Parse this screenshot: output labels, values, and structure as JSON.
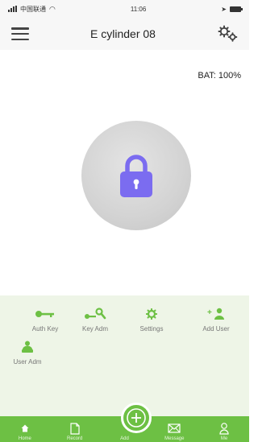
{
  "status_bar": {
    "carrier": "中国联通",
    "time": "11:06"
  },
  "header": {
    "title": "E cylinder 08"
  },
  "battery": {
    "text": "BAT: 100%"
  },
  "lock": {
    "icon": "lock-icon"
  },
  "actions": [
    {
      "label": "Auth Key",
      "icon": "key-icon"
    },
    {
      "label": "Key Adm",
      "icon": "key-admin-icon"
    },
    {
      "label": "Settings",
      "icon": "gear-icon"
    },
    {
      "label": "Add User",
      "icon": "add-user-icon"
    },
    {
      "label": "User Adm",
      "icon": "users-icon"
    }
  ],
  "tabs": [
    {
      "label": "Home",
      "icon": "home-icon"
    },
    {
      "label": "Record",
      "icon": "document-icon"
    },
    {
      "label": "Add",
      "icon": "plus-circle-icon"
    },
    {
      "label": "Message",
      "icon": "envelope-icon"
    },
    {
      "label": "Me",
      "icon": "person-icon"
    }
  ],
  "colors": {
    "accent_green": "#6dc044",
    "lock_purple": "#7b6cf0",
    "panel_bg": "#eef5e7"
  }
}
